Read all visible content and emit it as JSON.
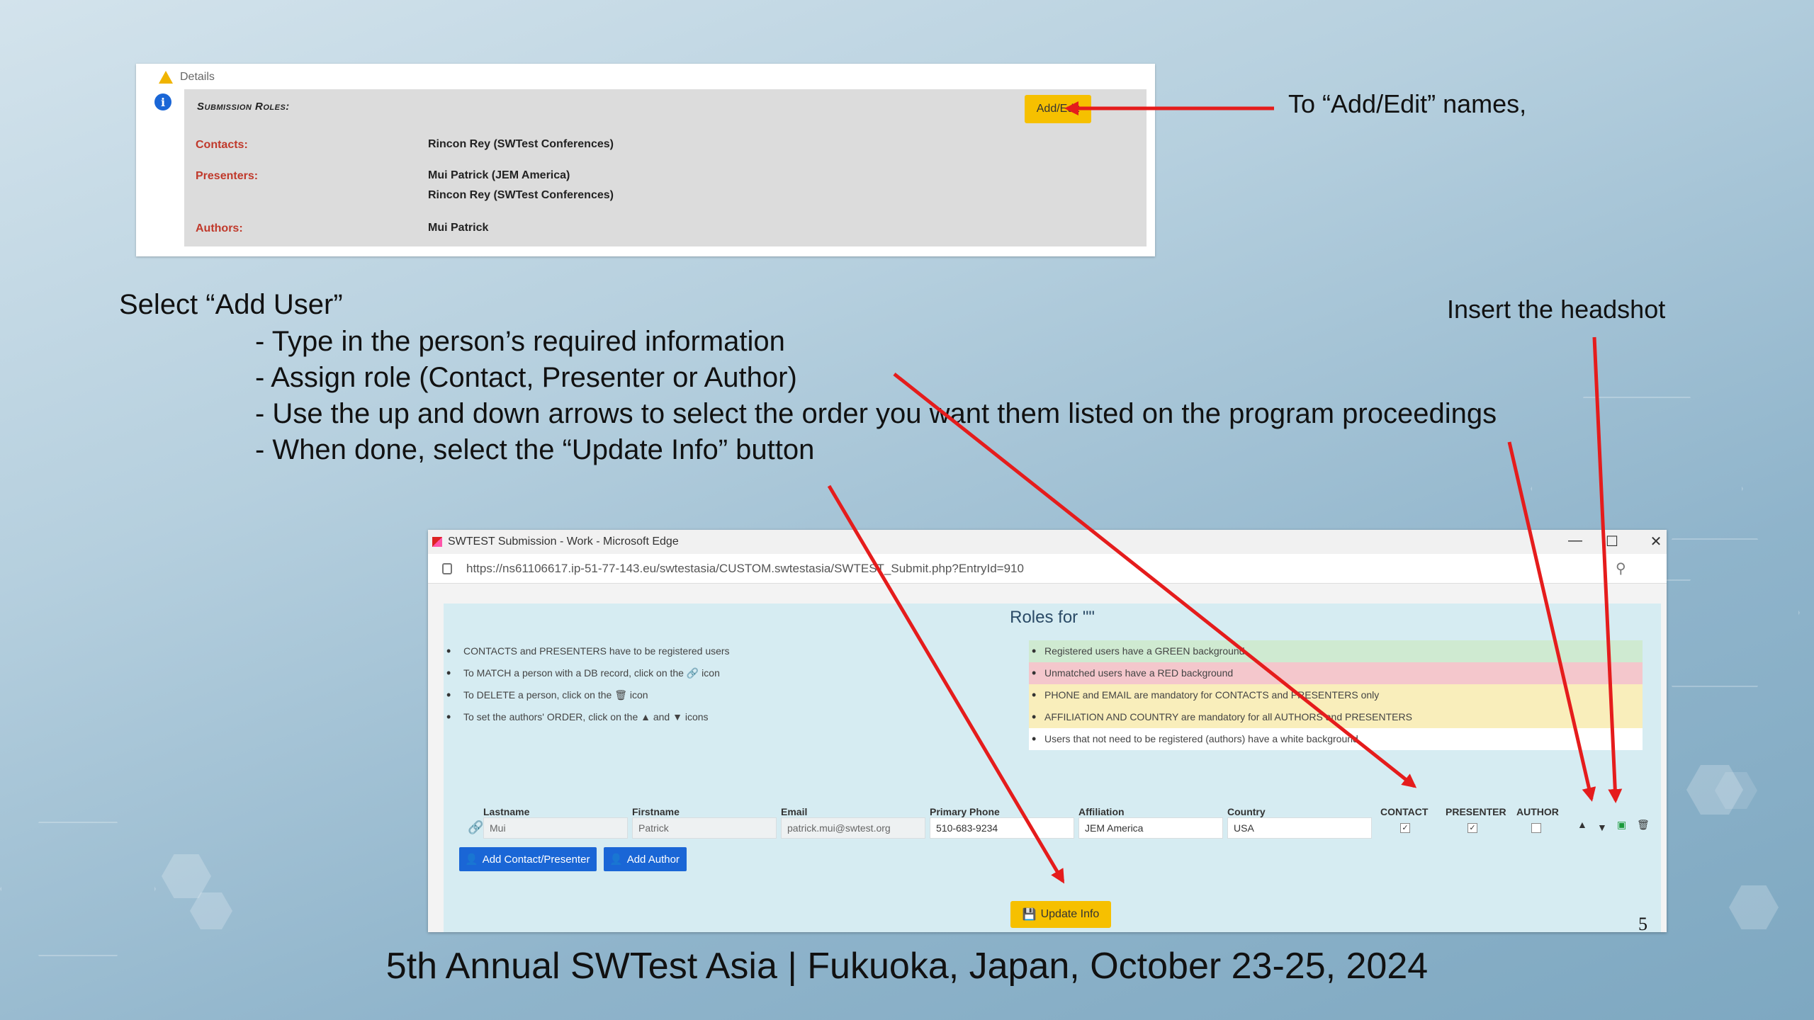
{
  "colors": {
    "arrow": "#e51c1c",
    "button_yellow": "#f6c000",
    "button_blue": "#1a66d6",
    "role_red": "#c0392b"
  },
  "details_panel": {
    "header_label": "Details",
    "section_title": "Submission Roles:",
    "add_edit_label": "Add/Edit",
    "contacts_label": "Contacts:",
    "contacts_value": "Rincon Rey (SWTest Conferences)",
    "presenters_label": "Presenters:",
    "presenters_value_1": "Mui Patrick (JEM America)",
    "presenters_value_2": "Rincon Rey (SWTest Conferences)",
    "authors_label": "Authors:",
    "authors_value": "Mui Patrick"
  },
  "callouts": {
    "add_edit": "To “Add/Edit” names,",
    "headshot": "Insert the headshot"
  },
  "instructions": {
    "title": "Select “Add User”",
    "steps": [
      "- Type in the person’s required information",
      "- Assign role (Contact, Presenter or Author)",
      "- Use the up and down arrows to select the order you want them listed on the program proceedings",
      "- When done, select the “Update Info” button"
    ]
  },
  "browser": {
    "title": "SWTEST Submission - Work - Microsoft Edge",
    "url": "https://ns61106617.ip-51-77-143.eu/swtestasia/CUSTOM.swtestasia/SWTEST_Submit.php?EntryId=910",
    "minimize": "—",
    "maximize": "☐",
    "close": "✕",
    "zoom_icon": "⚲"
  },
  "roles_page": {
    "heading": "Roles for \"\"",
    "notes_left": [
      "CONTACTS and PRESENTERS have to be registered users",
      "To MATCH a person with a DB record, click on the 🔗 icon",
      "To DELETE a person, click on the 🗑 icon",
      "To set the authors' ORDER, click on the ▲ and ▼ icons"
    ],
    "notes_right": [
      "Registered users have a GREEN background",
      "Unmatched users have a RED background",
      "PHONE and EMAIL are mandatory for CONTACTS and PRESENTERS only",
      "AFFILIATION AND COUNTRY are mandatory for all AUTHORS and PRESENTERS",
      "Users that not need to be registered (authors) have a white background"
    ],
    "columns": [
      "Lastname",
      "Firstname",
      "Email",
      "Primary Phone",
      "Affiliation",
      "Country",
      "CONTACT",
      "PRESENTER",
      "AUTHOR"
    ],
    "row": {
      "lastname": "Mui",
      "firstname": "Patrick",
      "email": "patrick.mui@swtest.org",
      "phone": "510-683-9234",
      "affiliation": "JEM America",
      "country": "USA",
      "contact": true,
      "presenter": true,
      "author": false
    },
    "add_contact_label": "Add Contact/Presenter",
    "add_author_label": "Add Author",
    "update_info_label": "Update Info"
  },
  "slide_number": "5",
  "footer": "5th Annual SWTest Asia | Fukuoka, Japan, October 23-25, 2024"
}
